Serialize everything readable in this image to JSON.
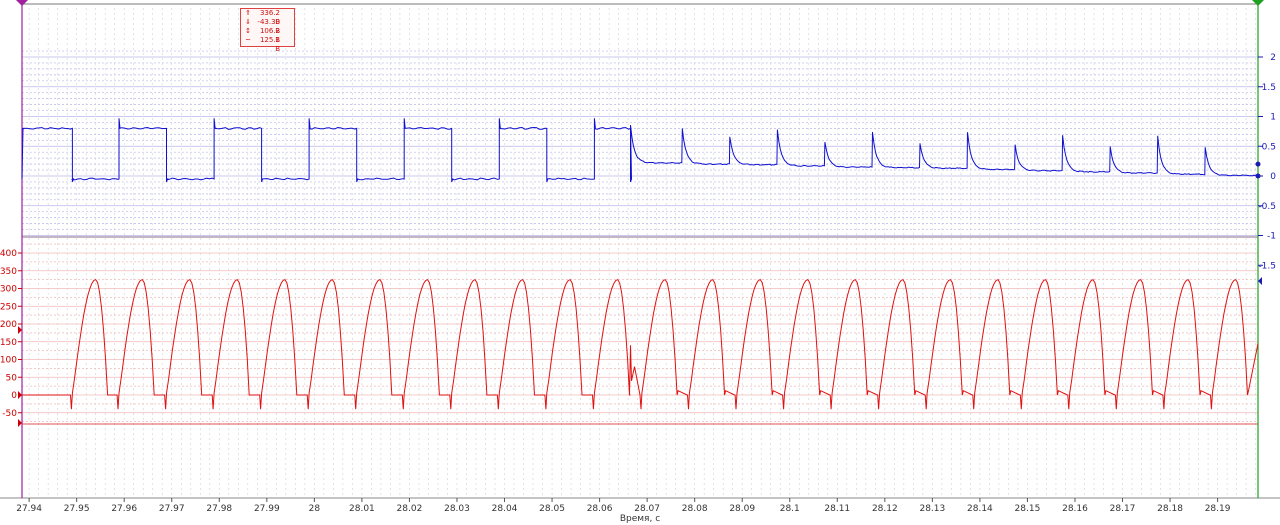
{
  "colors": {
    "blue_trace": "#1010d0",
    "red_trace": "#e01010",
    "left_marker": "#a020a0",
    "right_marker": "#20a020",
    "grid_blue": "#b8b8e8",
    "grid_red": "#f0b8b8"
  },
  "stats": {
    "max": {
      "icon": "arrow-up-icon",
      "symbol": "⇑",
      "value": "336.2 В"
    },
    "min": {
      "icon": "arrow-down-icon",
      "symbol": "⇓",
      "value": "-43.30 В"
    },
    "pp": {
      "icon": "peak-to-peak-icon",
      "symbol": "↕",
      "value": "106.2 В"
    },
    "avg": {
      "icon": "average-icon",
      "symbol": "~",
      "value": "125.1 В"
    }
  },
  "chart_data": [
    {
      "type": "line",
      "series": [
        {
          "trace": "blue"
        }
      ],
      "ylim": [
        -1,
        2
      ],
      "y_ticks": [
        "2",
        "1.5",
        "1",
        "0.5",
        "0",
        "-0.5",
        "-1",
        "-1.5"
      ],
      "x_ticks": [
        "27.94",
        "27.95",
        "27.96",
        "27.97",
        "27.98",
        "27.99",
        "28",
        "28.01",
        "28.02",
        "28.03",
        "28.04",
        "28.05",
        "28.06",
        "28.07",
        "28.08",
        "28.09",
        "28.1",
        "28.11",
        "28.12",
        "28.13",
        "28.14",
        "28.15",
        "28.16",
        "28.17",
        "28.18",
        "28.19"
      ],
      "xlim": [
        27.9385,
        28.1985
      ],
      "xlabel": "Время, с",
      "square_wave": {
        "high_level": 0.8,
        "low_level": -0.05,
        "edges": [
          27.9491,
          27.9589,
          27.9689,
          27.9789,
          27.9889,
          27.9989,
          28.0089,
          28.0189,
          28.0289,
          28.0389,
          28.0489,
          28.0589,
          28.0665
        ]
      },
      "decay_spikes": [
        {
          "t": 28.0665,
          "peak": 0.85,
          "base": 0.22
        },
        {
          "t": 28.0774,
          "peak": 0.8,
          "base": 0.2
        },
        {
          "t": 28.0874,
          "peak": 0.66,
          "base": 0.19
        },
        {
          "t": 28.0974,
          "peak": 0.78,
          "base": 0.17
        },
        {
          "t": 28.1074,
          "peak": 0.57,
          "base": 0.15
        },
        {
          "t": 28.1174,
          "peak": 0.74,
          "base": 0.14
        },
        {
          "t": 28.1274,
          "peak": 0.55,
          "base": 0.13
        },
        {
          "t": 28.1374,
          "peak": 0.73,
          "base": 0.11
        },
        {
          "t": 28.1474,
          "peak": 0.52,
          "base": 0.09
        },
        {
          "t": 28.1574,
          "peak": 0.68,
          "base": 0.07
        },
        {
          "t": 28.1674,
          "peak": 0.49,
          "base": 0.05
        },
        {
          "t": 28.1774,
          "peak": 0.67,
          "base": 0.03
        },
        {
          "t": 28.1874,
          "peak": 0.48,
          "base": 0.01
        }
      ],
      "end_value": 0.0
    },
    {
      "type": "line",
      "series": [
        {
          "trace": "red"
        }
      ],
      "ylim": [
        -75,
        425
      ],
      "y_ticks": [
        "400",
        "350",
        "300",
        "250",
        "200",
        "150",
        "100",
        "50",
        "0",
        "-50"
      ],
      "pulse_starts": [
        27.9491,
        27.9589,
        27.9689,
        27.9789,
        27.9889,
        27.9989,
        28.0089,
        28.0189,
        28.0289,
        28.0389,
        28.0489,
        28.0589,
        28.0689,
        28.0789,
        28.0889,
        28.0989,
        28.1089,
        28.1189,
        28.1289,
        28.1389,
        28.1489,
        28.1589,
        28.1689,
        28.1789,
        28.1889
      ],
      "pulse": {
        "peak": 325,
        "rise_ms": 4.9,
        "fall_ms": 2.5,
        "dip": -40,
        "baseline": 0
      },
      "glitch": {
        "t": 28.0665,
        "peak": 140
      },
      "end_value": 145
    }
  ]
}
